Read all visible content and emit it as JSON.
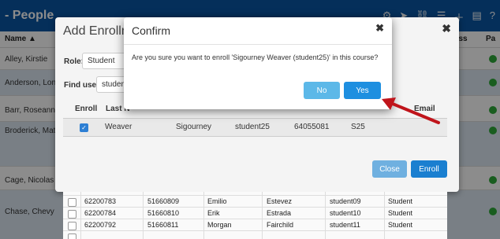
{
  "header": {
    "title": "- People"
  },
  "background_table": {
    "col_name": "Name",
    "col_sort_icon": "sort-arrow-up",
    "col_progress": "ress",
    "col_last": "Pa",
    "rows": [
      "Alley, Kirstie",
      "Anderson, Loni",
      "Barr, Roseanne",
      "Broderick, Matthe",
      "Cage, Nicolas",
      "Chase, Chevy"
    ]
  },
  "enroll_modal": {
    "title": "Add Enrollme",
    "role_label": "Role:",
    "role_value": "Student",
    "find_user_label": "Find user:",
    "find_user_value": "studen",
    "headers": {
      "enroll": "Enroll",
      "last": "Last N",
      "email": "Email"
    },
    "selected_row": {
      "last": "Weaver",
      "first": "Sigourney",
      "user": "student25",
      "id": "64055081",
      "extra": "S25"
    },
    "close_label": "Close",
    "enroll_label": "Enroll"
  },
  "lower_rows": [
    [
      "62200783",
      "51660809",
      "Emilio",
      "Estevez",
      "student09",
      "Student"
    ],
    [
      "62200784",
      "51660810",
      "Erik",
      "Estrada",
      "student10",
      "Student"
    ],
    [
      "62200792",
      "51660811",
      "Morgan",
      "Fairchild",
      "student11",
      "Student"
    ]
  ],
  "confirm": {
    "title": "Confirm",
    "message": "Are you sure you want to enroll 'Sigourney Weaver (student25)' in this course?",
    "no_label": "No",
    "yes_label": "Yes"
  },
  "colors": {
    "header": "#0a56a5",
    "yes": "#1e8fe0",
    "no": "#5cb8e8",
    "arrow": "#c0141b"
  }
}
